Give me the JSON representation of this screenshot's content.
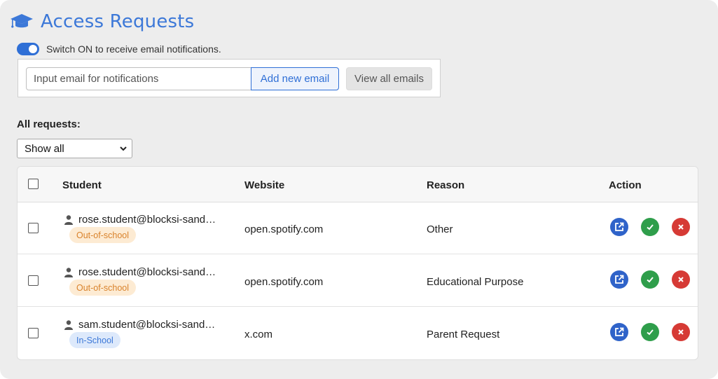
{
  "header": {
    "title": "Access Requests",
    "icon": "graduation-cap-icon",
    "accent": "#3c78d8"
  },
  "notifications": {
    "toggle_on": true,
    "toggle_label": "Switch ON to receive email notifications.",
    "email_placeholder": "Input email for notifications",
    "add_label": "Add new email",
    "view_label": "View all emails"
  },
  "filter": {
    "label": "All requests:",
    "selected": "Show all"
  },
  "table": {
    "columns": {
      "student": "Student",
      "website": "Website",
      "reason": "Reason",
      "action": "Action"
    },
    "rows": [
      {
        "student": "rose.student@blocksi-sand…",
        "badge": "Out-of-school",
        "website": "open.spotify.com",
        "reason": "Other"
      },
      {
        "student": "rose.student@blocksi-sand…",
        "badge": "Out-of-school",
        "website": "open.spotify.com",
        "reason": "Educational Purpose"
      },
      {
        "student": "sam.student@blocksi-sand…",
        "badge": "In-School",
        "website": "x.com",
        "reason": "Parent Request"
      }
    ]
  },
  "colors": {
    "open": "#2f63c9",
    "approve": "#2f9e4b",
    "deny": "#d63a35"
  }
}
